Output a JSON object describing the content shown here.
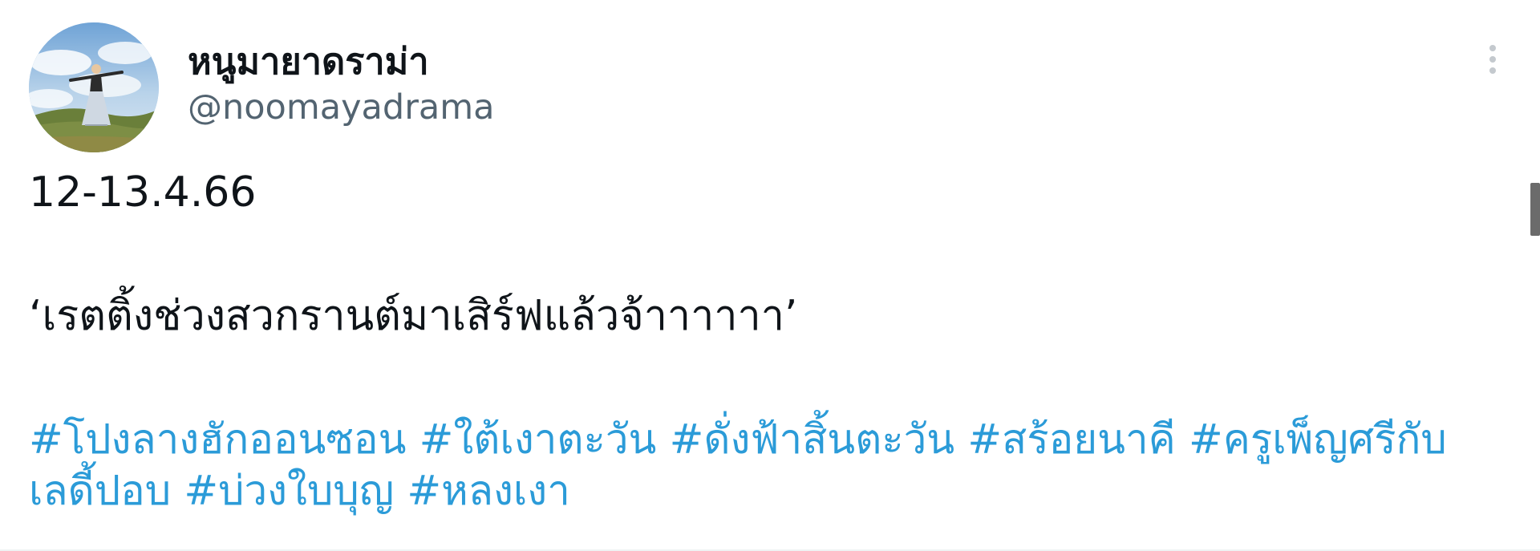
{
  "author": {
    "display_name": "หนูมายาดราม่า",
    "handle": "@noomayadrama",
    "avatar": "avatar-sound-of-music"
  },
  "tweet": {
    "line1": "12-13.4.66",
    "line2": "‘เรตติ้งช่วงสวกรานต์มาเสิร์ฟแล้วจ้าาาาาา’",
    "hashtags": [
      "#โปงลางฮักออนซอน",
      "#ใต้เงาตะวัน",
      "#ดั่งฟ้าสิ้นตะวัน",
      "#สร้อยนาคี",
      "#ครูเพ็ญศรีกับเลดี้ปอบ",
      "#บ่วงใบบุญ",
      "#หลงเงา"
    ],
    "hashtag_line1": "#โปงลางฮักออนซอน #ใต้เงาตะวัน #ดั่งฟ้าสิ้นตะวัน #สร้อยนาคี #ครูเพ็ญศรีกับ",
    "hashtag_line2": "เลดี้ปอบ #บ่วงใบบุญ #หลงเงา"
  },
  "icons": {
    "more": "more-vertical-icon"
  },
  "colors": {
    "text": "#0f1419",
    "handle": "#536471",
    "hashtag": "#2b9bd8",
    "more_icon": "#c4c9ce"
  }
}
